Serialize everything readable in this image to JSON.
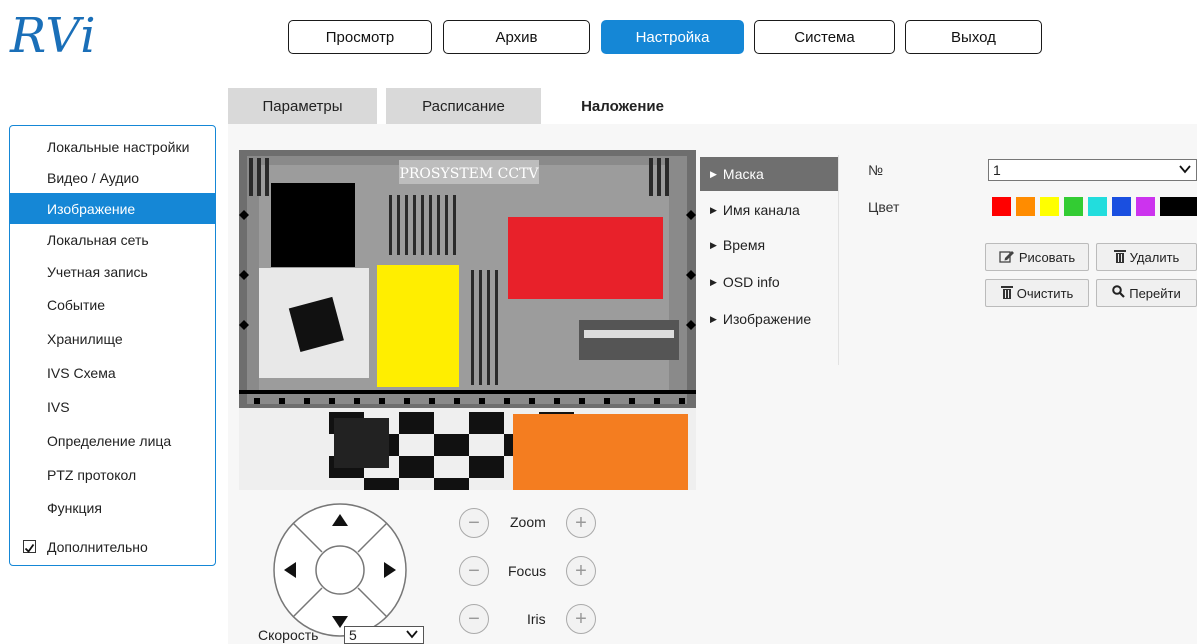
{
  "app": {
    "logo_text": "RVi"
  },
  "top_nav": [
    {
      "label": "Просмотр"
    },
    {
      "label": "Архив"
    },
    {
      "label": "Настройка",
      "active": true
    },
    {
      "label": "Система"
    },
    {
      "label": "Выход"
    }
  ],
  "tabs": [
    {
      "label": "Параметры"
    },
    {
      "label": "Расписание"
    },
    {
      "label": "Наложение",
      "active": true
    }
  ],
  "sidebar": {
    "items": [
      {
        "label": "Локальные настройки"
      },
      {
        "label": "Видео / Аудио"
      },
      {
        "label": "Изображение",
        "active": true
      },
      {
        "label": "Локальная сеть"
      },
      {
        "label": "Учетная запись"
      },
      {
        "label": "Событие"
      },
      {
        "label": "Хранилище"
      },
      {
        "label": "IVS Схема"
      },
      {
        "label": "IVS"
      },
      {
        "label": "Определение лица"
      },
      {
        "label": "PTZ протокол"
      },
      {
        "label": "Функция"
      }
    ],
    "advanced": {
      "label": "Дополнительно",
      "checked": true
    }
  },
  "video": {
    "overlay_text": "PROSYSTEM CCTV",
    "masks": [
      {
        "color": "#000000"
      },
      {
        "color": "#e8212a"
      },
      {
        "color": "#ffee00"
      },
      {
        "color": "#f47d20"
      }
    ]
  },
  "submenu": [
    {
      "label": "Маска",
      "active": true
    },
    {
      "label": "Имя канала"
    },
    {
      "label": "Время"
    },
    {
      "label": "OSD info"
    },
    {
      "label": "Изображение"
    }
  ],
  "mask_settings": {
    "number_label": "№",
    "number_value": "1",
    "color_label": "Цвет",
    "colors": [
      "#ff0000",
      "#ff8c00",
      "#ffff00",
      "#33cc33",
      "#22dddd",
      "#1a4fe0",
      "#cc33ee",
      "#000000"
    ],
    "draw_button": "Рисовать",
    "delete_button": "Удалить",
    "clear_button": "Очистить",
    "goto_button": "Перейти"
  },
  "ptz": {
    "zoom_label": "Zoom",
    "focus_label": "Focus",
    "iris_label": "Iris",
    "speed_label": "Скорость",
    "speed_value": "5",
    "minus_symbol": "−",
    "plus_symbol": "+"
  }
}
